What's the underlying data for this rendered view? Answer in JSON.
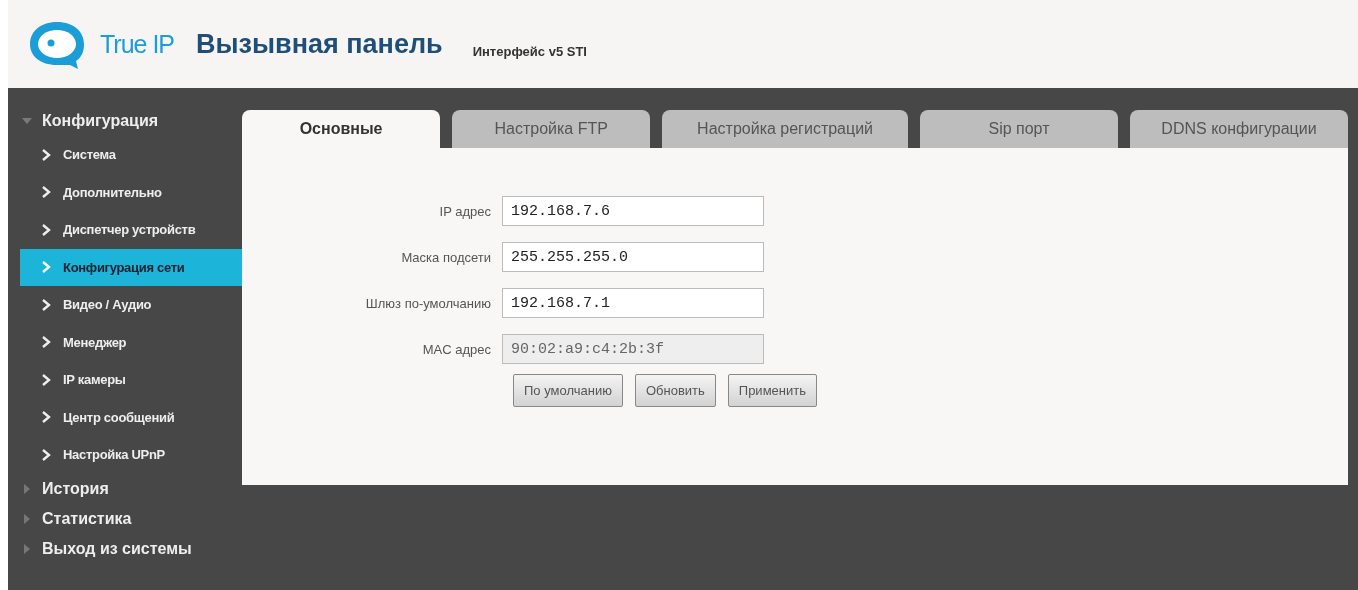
{
  "header": {
    "logo_text": "True IP",
    "title": "Вызывная панель",
    "subtitle": "Интерфейс v5 STI"
  },
  "sidebar": {
    "sections": [
      {
        "label": "Конфигурация",
        "expanded": true,
        "children": [
          {
            "label": "Система",
            "selected": false
          },
          {
            "label": "Дополнительно",
            "selected": false
          },
          {
            "label": "Диспетчер устройств",
            "selected": false
          },
          {
            "label": "Конфигурация сети",
            "selected": true
          },
          {
            "label": "Видео / Аудио",
            "selected": false
          },
          {
            "label": "Менеджер",
            "selected": false
          },
          {
            "label": "IP камеры",
            "selected": false
          },
          {
            "label": "Центр сообщений",
            "selected": false
          },
          {
            "label": "Настройка UPnP",
            "selected": false
          }
        ]
      },
      {
        "label": "История",
        "expanded": false
      },
      {
        "label": "Статистика",
        "expanded": false
      },
      {
        "label": "Выход из системы",
        "expanded": false
      }
    ]
  },
  "tabs": [
    {
      "label": "Основные",
      "selected": true
    },
    {
      "label": "Настройка FTP",
      "selected": false
    },
    {
      "label": "Настройка регистраций",
      "selected": false
    },
    {
      "label": "Sip порт",
      "selected": false
    },
    {
      "label": "DDNS конфигурации",
      "selected": false
    }
  ],
  "form": {
    "fields": [
      {
        "label": "IP адрес",
        "value": "192.168.7.6",
        "disabled": false
      },
      {
        "label": "Маска подсети",
        "value": "255.255.255.0",
        "disabled": false
      },
      {
        "label": "Шлюз по-умолчанию",
        "value": "192.168.7.1",
        "disabled": false
      },
      {
        "label": "MAC адрес",
        "value": "90:02:a9:c4:2b:3f",
        "disabled": true
      }
    ],
    "buttons": [
      "По умолчанию",
      "Обновить",
      "Применить"
    ]
  }
}
